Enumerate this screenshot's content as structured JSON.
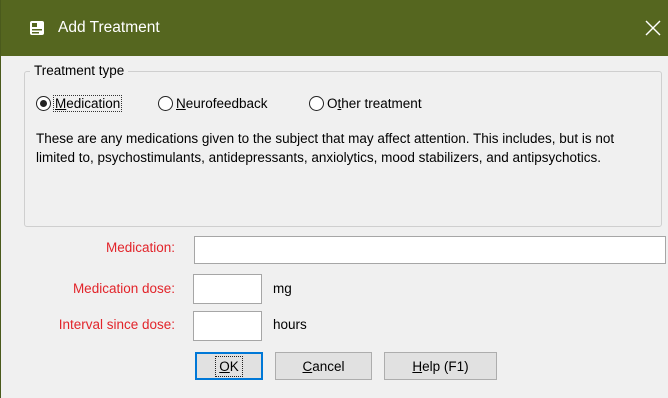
{
  "window": {
    "title": "Add Treatment",
    "icon": "dialog-icon",
    "close_icon": "close-icon",
    "colors": {
      "titlebar": "#55661f",
      "label_required": "#e2242a",
      "background": "#f0f0f0"
    }
  },
  "treatment_type": {
    "legend": "Treatment type",
    "options": [
      {
        "label": "Medication",
        "mnemonic": "M",
        "rest": "edication",
        "selected": true
      },
      {
        "label": "Neurofeedback",
        "mnemonic": "N",
        "rest": "eurofeedback",
        "selected": false
      },
      {
        "label": "Other treatment",
        "prefix": "O",
        "mnemonic": "t",
        "rest": "her treatment",
        "selected": false
      }
    ],
    "description": "These are any medications given to the subject that may affect attention. This includes, but is not limited to, psychostimulants, antidepressants, anxiolytics, mood stabilizers, and antipsychotics."
  },
  "form": {
    "medication": {
      "label": "Medication:",
      "value": ""
    },
    "dose": {
      "label": "Medication dose:",
      "value": "",
      "unit": "mg"
    },
    "interval": {
      "label": "Interval since dose:",
      "value": "",
      "unit": "hours"
    }
  },
  "buttons": {
    "ok": {
      "mnemonic": "O",
      "rest": "K"
    },
    "cancel": {
      "mnemonic": "C",
      "rest": "ancel"
    },
    "help": {
      "mnemonic": "H",
      "rest": "elp (F1)"
    }
  }
}
